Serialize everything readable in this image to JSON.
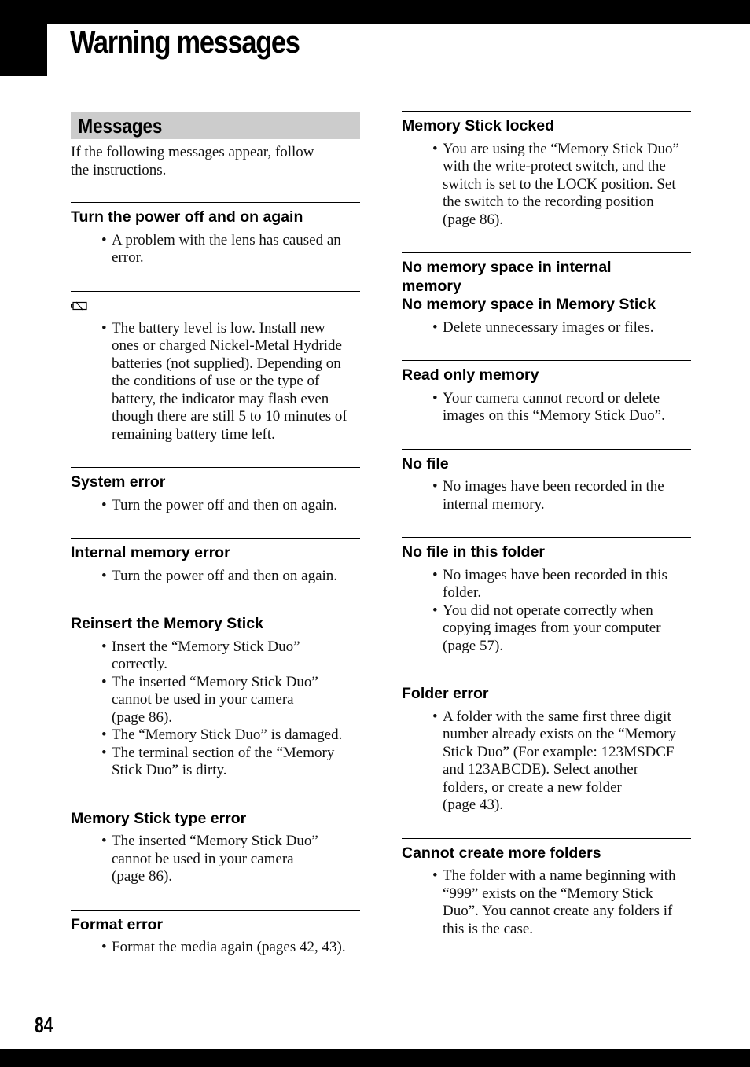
{
  "page": {
    "title": "Warning messages",
    "page_number": "84"
  },
  "section": {
    "heading": "Messages",
    "intro_lines": [
      "If the following messages appear, follow",
      "the instructions."
    ]
  },
  "left_messages": [
    {
      "title_lines": [
        "Turn the power off and on again"
      ],
      "bullets": [
        [
          "A problem with the lens has caused an",
          "error."
        ]
      ]
    },
    {
      "icon": "battery-empty-icon",
      "title_lines": [],
      "bullets": [
        [
          "The battery level is low. Install new",
          "ones or charged Nickel-Metal Hydride",
          "batteries (not supplied). Depending on",
          "the conditions of use or the type of",
          "battery, the indicator may flash even",
          "though there are still 5 to 10 minutes of",
          "remaining battery time left."
        ]
      ]
    },
    {
      "title_lines": [
        "System error"
      ],
      "bullets": [
        [
          "Turn the power off and then on again."
        ]
      ]
    },
    {
      "title_lines": [
        "Internal memory error"
      ],
      "bullets": [
        [
          "Turn the power off and then on again."
        ]
      ]
    },
    {
      "title_lines": [
        "Reinsert the Memory Stick"
      ],
      "bullets": [
        [
          "Insert the “Memory Stick Duo”",
          "correctly."
        ],
        [
          "The inserted “Memory Stick Duo”",
          "cannot be used in your camera",
          "(page 86)."
        ],
        [
          "The “Memory Stick Duo” is damaged."
        ],
        [
          "The terminal section of the “Memory",
          "Stick Duo” is dirty."
        ]
      ]
    },
    {
      "title_lines": [
        "Memory Stick type error"
      ],
      "bullets": [
        [
          "The inserted “Memory Stick Duo”",
          "cannot be used in your camera",
          "(page 86)."
        ]
      ]
    },
    {
      "title_lines": [
        "Format error"
      ],
      "bullets": [
        [
          "Format the media again (pages 42, 43)."
        ]
      ]
    }
  ],
  "right_messages": [
    {
      "title_lines": [
        "Memory Stick locked"
      ],
      "bullets": [
        [
          "You are using the “Memory Stick Duo”",
          "with the write-protect switch, and the",
          "switch is set to the LOCK position. Set",
          "the switch to the recording position",
          "(page 86)."
        ]
      ]
    },
    {
      "title_lines": [
        "No memory space in internal",
        "memory",
        "No memory space in Memory Stick"
      ],
      "bullets": [
        [
          "Delete unnecessary images or files."
        ]
      ]
    },
    {
      "title_lines": [
        "Read only memory"
      ],
      "bullets": [
        [
          "Your camera cannot record or delete",
          "images on this “Memory Stick Duo”."
        ]
      ]
    },
    {
      "title_lines": [
        "No file"
      ],
      "bullets": [
        [
          "No images have been recorded in the",
          "internal memory."
        ]
      ]
    },
    {
      "title_lines": [
        "No file in this folder"
      ],
      "bullets": [
        [
          "No images have been recorded in this",
          "folder."
        ],
        [
          "You did not operate correctly when",
          "copying images from your computer",
          "(page 57)."
        ]
      ]
    },
    {
      "title_lines": [
        "Folder error"
      ],
      "bullets": [
        [
          "A folder with the same first three digit",
          "number already exists on the “Memory",
          "Stick Duo” (For example: 123MSDCF",
          "and 123ABCDE). Select another",
          "folders, or create a new folder",
          "(page 43)."
        ]
      ]
    },
    {
      "title_lines": [
        "Cannot create more folders"
      ],
      "bullets": [
        [
          "The folder with a name beginning with",
          "“999” exists on the “Memory Stick",
          "Duo”. You cannot create any folders if",
          "this is the case."
        ]
      ]
    }
  ],
  "bullet_glyph": "•"
}
